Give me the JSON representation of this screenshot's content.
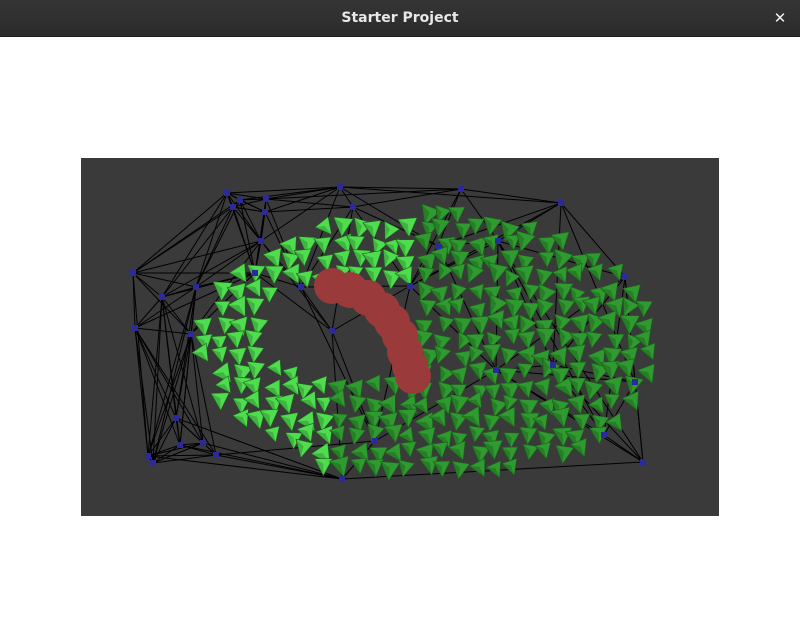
{
  "window": {
    "title": "Starter Project",
    "close_glyph": "✕"
  },
  "scene": {
    "background_color": "#3a3a3a",
    "node_color": "#2a2a9a",
    "edge_color": "#000000",
    "agent_color_bright": "#4fdc4f",
    "agent_color_dark": "#2f9a2f",
    "obstacle_color": "#9a3a3a",
    "obstacle_description_icon": "obstacle-circles"
  }
}
